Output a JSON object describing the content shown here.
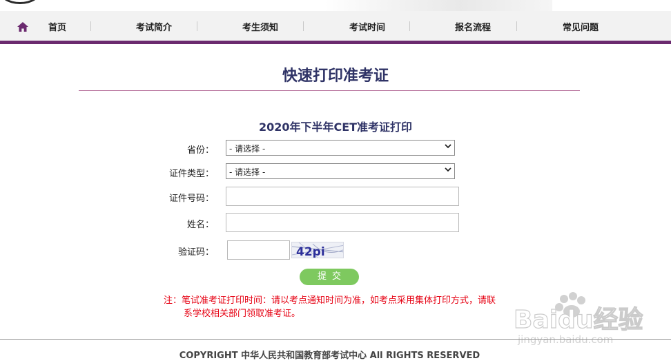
{
  "nav": {
    "home_icon": "home-icon",
    "items": [
      "首页",
      "考试简介",
      "考生须知",
      "考试时间",
      "报名流程",
      "常见问题"
    ],
    "accent": "#6b2a6f"
  },
  "page": {
    "title": "快速打印准考证",
    "subtitle": "2020年下半年CET准考证打印"
  },
  "form": {
    "province_label": "省份：",
    "province_value": "- 请选择 -",
    "id_type_label": "证件类型：",
    "id_type_value": "- 请选择 -",
    "id_number_label": "证件号码：",
    "name_label": "姓名：",
    "captcha_label": "验证码：",
    "captcha_text": "42pi",
    "submit_label": "提交"
  },
  "note": {
    "line1": "注：笔试准考证打印时间：请以考点通知时间为准，如考点采用集体打印方式，请联",
    "line2": "系学校相关部门领取准考证。"
  },
  "footer": {
    "copyright": "COPYRIGHT 中华人民共和国教育部考试中心 All RIGHTS RESERVED"
  },
  "watermark": {
    "brand": "Baidu经验",
    "url": "jingyan.baidu.com"
  },
  "colors": {
    "title": "#2f3366",
    "rule": "#b9769f",
    "submit": "#7ec95f",
    "note": "#e60012"
  }
}
